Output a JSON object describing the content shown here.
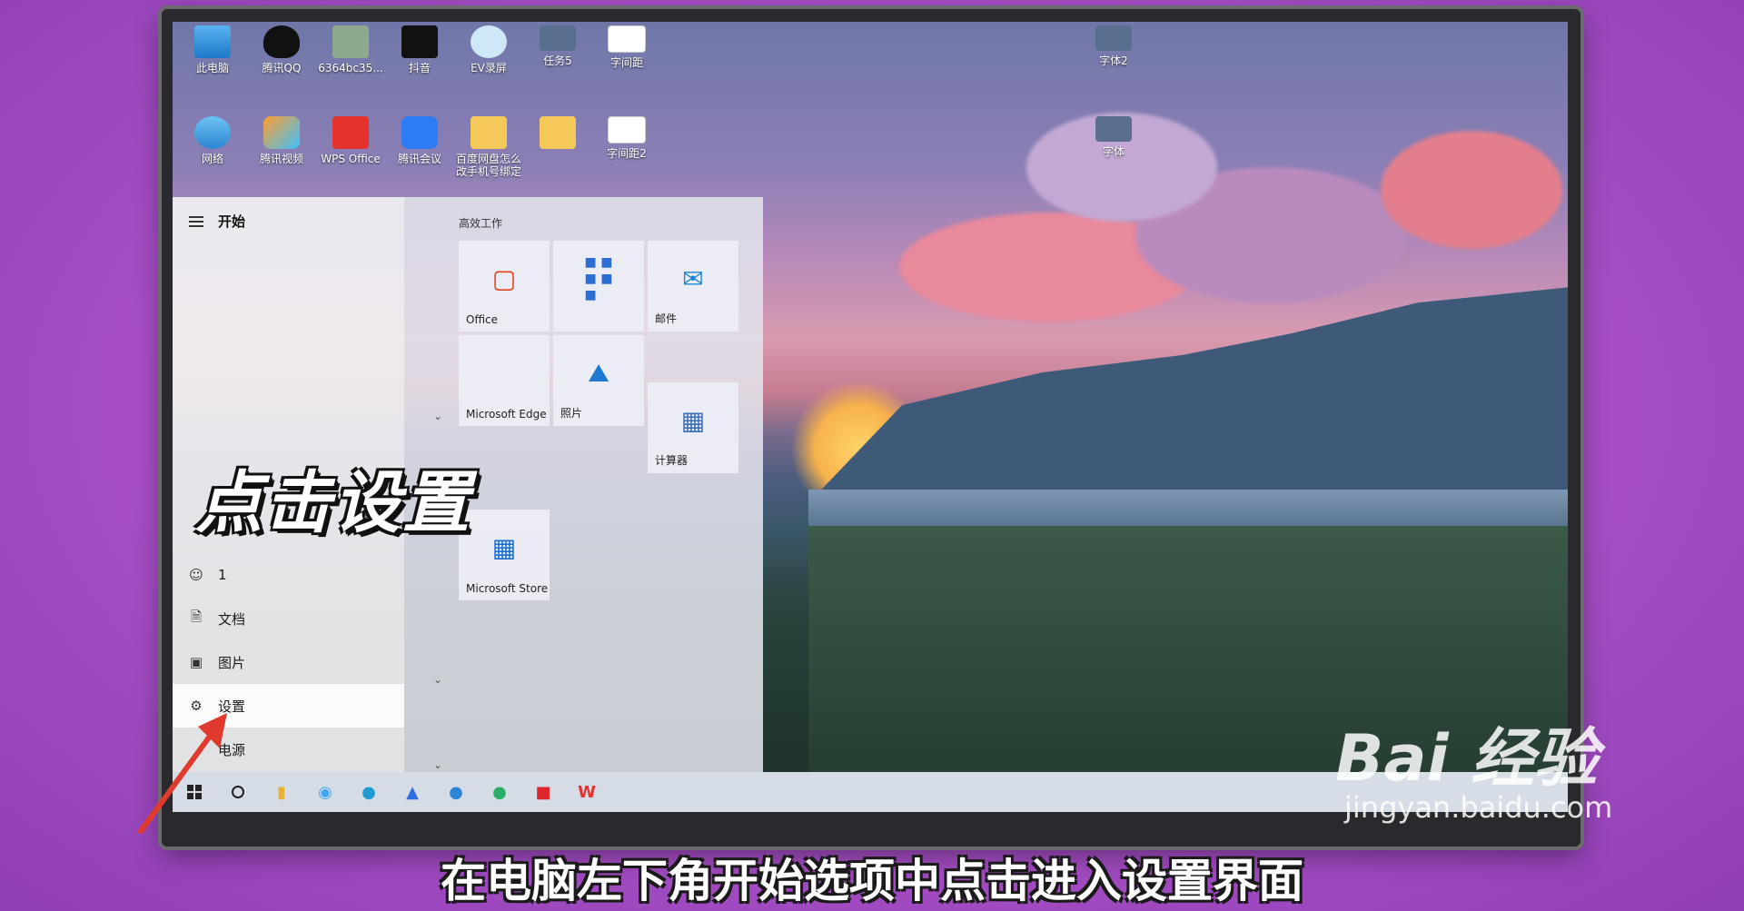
{
  "desktop": {
    "icons_row1": [
      {
        "label": "此电脑",
        "icon": "computer-icon"
      },
      {
        "label": "腾讯QQ",
        "icon": "qq-icon"
      },
      {
        "label": "6364bc35...",
        "icon": "image-file-icon"
      },
      {
        "label": "抖音",
        "icon": "douyin-icon"
      },
      {
        "label": "EV录屏",
        "icon": "ev-recorder-icon"
      },
      {
        "label": "任务5",
        "icon": "video-file-icon"
      },
      {
        "label": "字间距",
        "icon": "document-icon"
      }
    ],
    "icons_row2": [
      {
        "label": "网络",
        "icon": "network-icon"
      },
      {
        "label": "腾讯视频",
        "icon": "tencent-video-icon"
      },
      {
        "label": "WPS Office",
        "icon": "wps-icon"
      },
      {
        "label": "腾讯会议",
        "icon": "tencent-meeting-icon"
      },
      {
        "label": "百度网盘怎么改手机号绑定",
        "icon": "folder-icon"
      },
      {
        "label": "",
        "icon": "folder-icon"
      },
      {
        "label": "字间距2",
        "icon": "document-icon"
      }
    ],
    "icons_right": [
      {
        "label": "字体2",
        "icon": "video-file-icon"
      },
      {
        "label": "字体",
        "icon": "video-file-icon"
      }
    ]
  },
  "start_menu": {
    "title": "开始",
    "group_title": "高效工作",
    "tiles": [
      {
        "label": "Office",
        "icon": "office-icon"
      },
      {
        "label": "",
        "icon": "office-apps-icon"
      },
      {
        "label": "邮件",
        "icon": "mail-icon"
      },
      {
        "label": "Microsoft Edge",
        "icon": "edge-icon"
      },
      {
        "label": "照片",
        "icon": "photos-icon"
      },
      {
        "label": "计算器",
        "icon": "calculator-icon"
      },
      {
        "label": "Microsoft Store",
        "icon": "store-icon"
      }
    ],
    "rail": {
      "user": "1",
      "documents": "文档",
      "pictures": "图片",
      "settings": "设置",
      "power": "电源"
    }
  },
  "taskbar": {
    "items": [
      "start-icon",
      "search-circle-icon",
      "file-explorer-icon",
      "qq-browser-icon",
      "edge-icon",
      "feishu-icon",
      "sogou-icon",
      "wechat-icon",
      "netease-music-icon",
      "wps-icon"
    ]
  },
  "overlay": {
    "title": "点击设置",
    "caption": "在电脑左下角开始选项中点击进入设置界面"
  },
  "watermark": {
    "logo": "Bai  经验",
    "url": "jingyan.baidu.com"
  },
  "colors": {
    "background": "#a94fc6",
    "arrow": "#e03a2e",
    "caption_text": "#ffffff"
  }
}
